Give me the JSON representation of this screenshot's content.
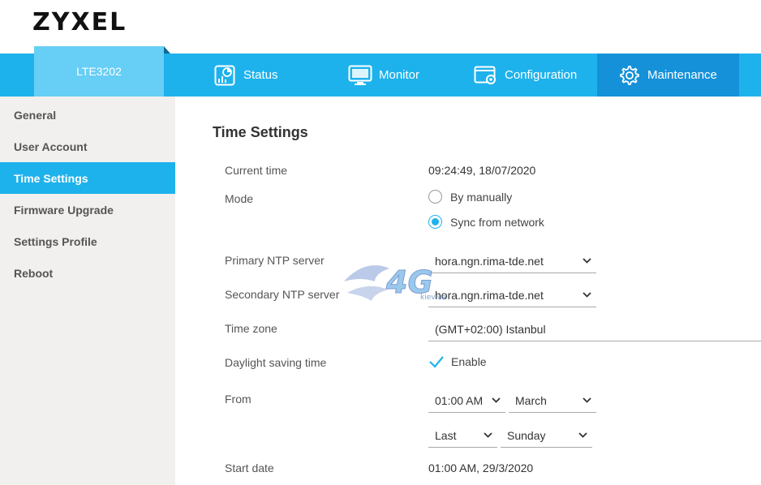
{
  "brand": "ZYXEL",
  "model": "LTE3202",
  "nav": [
    {
      "label": "Status",
      "icon": "status-icon"
    },
    {
      "label": "Monitor",
      "icon": "monitor-icon"
    },
    {
      "label": "Configuration",
      "icon": "configuration-icon"
    },
    {
      "label": "Maintenance",
      "icon": "gear-icon",
      "active": true
    }
  ],
  "sidebar": {
    "items": [
      {
        "label": "General"
      },
      {
        "label": "User Account"
      },
      {
        "label": "Time Settings",
        "active": true
      },
      {
        "label": "Firmware Upgrade"
      },
      {
        "label": "Settings Profile"
      },
      {
        "label": "Reboot"
      }
    ]
  },
  "main": {
    "title": "Time Settings",
    "current_time_label": "Current time",
    "current_time_value": "09:24:49, 18/07/2020",
    "mode_label": "Mode",
    "mode_options": [
      "By manually",
      "Sync from network"
    ],
    "mode_selected": "Sync from network",
    "primary_ntp_label": "Primary NTP server",
    "primary_ntp_value": "hora.ngn.rima-tde.net",
    "secondary_ntp_label": "Secondary NTP server",
    "secondary_ntp_value": "hora.ngn.rima-tde.net",
    "timezone_label": "Time zone",
    "timezone_value": "(GMT+02:00) Istanbul",
    "dst_label": "Daylight saving time",
    "dst_option": "Enable",
    "dst_enabled": true,
    "from_label": "From",
    "from_time": "01:00 AM",
    "from_month": "March",
    "from_week": "Last",
    "from_day": "Sunday",
    "start_date_label": "Start date",
    "start_date_value": "01:00 AM, 29/3/2020"
  },
  "watermark": {
    "text": "4G",
    "subtext": "kiev.ua"
  },
  "colors": {
    "accent": "#1eb2ec",
    "active_nav": "#1591d9",
    "model_tab": "#67cef5",
    "sidebar_bg": "#f2f0ee"
  }
}
